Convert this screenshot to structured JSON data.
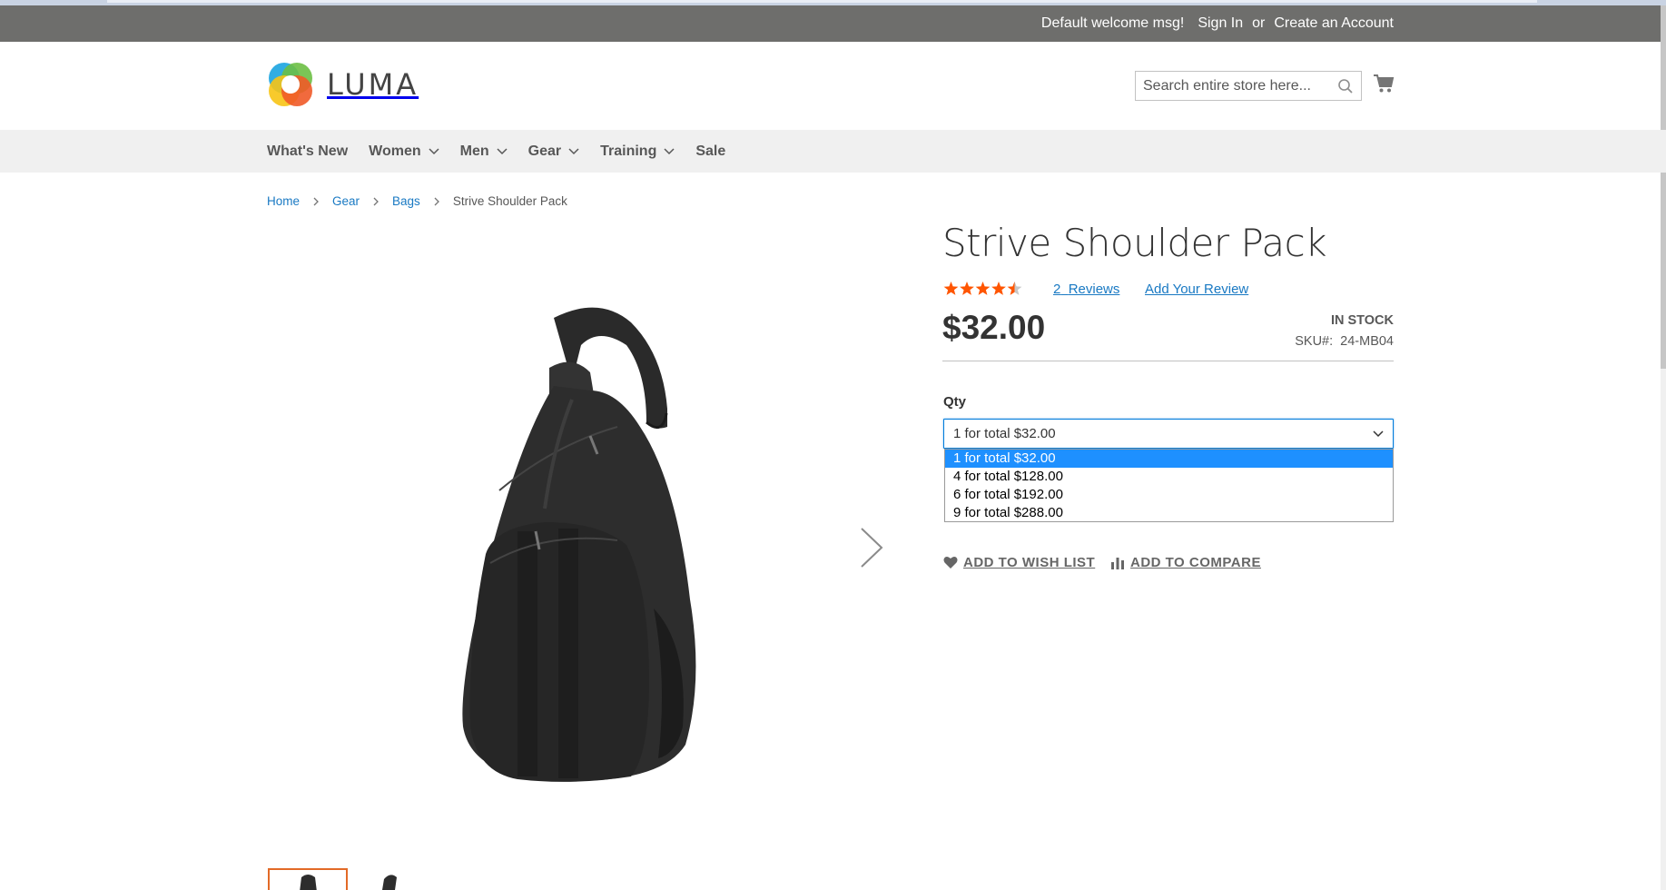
{
  "header": {
    "welcome": "Default welcome msg!",
    "sign_in": "Sign In",
    "or": "or",
    "create_account": "Create an Account"
  },
  "logo": {
    "text": "LUMA"
  },
  "search": {
    "placeholder": "Search entire store here..."
  },
  "nav": {
    "items": [
      {
        "label": "What's New",
        "has_submenu": false
      },
      {
        "label": "Women",
        "has_submenu": true
      },
      {
        "label": "Men",
        "has_submenu": true
      },
      {
        "label": "Gear",
        "has_submenu": true
      },
      {
        "label": "Training",
        "has_submenu": true
      },
      {
        "label": "Sale",
        "has_submenu": false
      }
    ]
  },
  "breadcrumbs": {
    "items": [
      "Home",
      "Gear",
      "Bags"
    ],
    "current": "Strive Shoulder Pack"
  },
  "product": {
    "title": "Strive Shoulder Pack",
    "rating_stars": 4.5,
    "reviews_count": "2",
    "reviews_label": "Reviews",
    "add_review": "Add Your Review",
    "price": "$32.00",
    "stock": "IN STOCK",
    "sku_label": "SKU#:",
    "sku": "24-MB04"
  },
  "qty": {
    "label": "Qty",
    "selected": "1 for total $32.00",
    "options": [
      "1 for total $32.00",
      "4 for total $128.00",
      "6 for total $192.00",
      "9 for total $288.00"
    ]
  },
  "actions": {
    "wishlist": "ADD TO WISH LIST",
    "compare": "ADD TO COMPARE"
  },
  "colors": {
    "header_bg": "#6e6e6c",
    "nav_bg": "#f0f0f0",
    "link": "#1979c3",
    "star": "#ff5501",
    "selected_option": "#1e90ff",
    "thumb_active_border": "#e26a27"
  }
}
